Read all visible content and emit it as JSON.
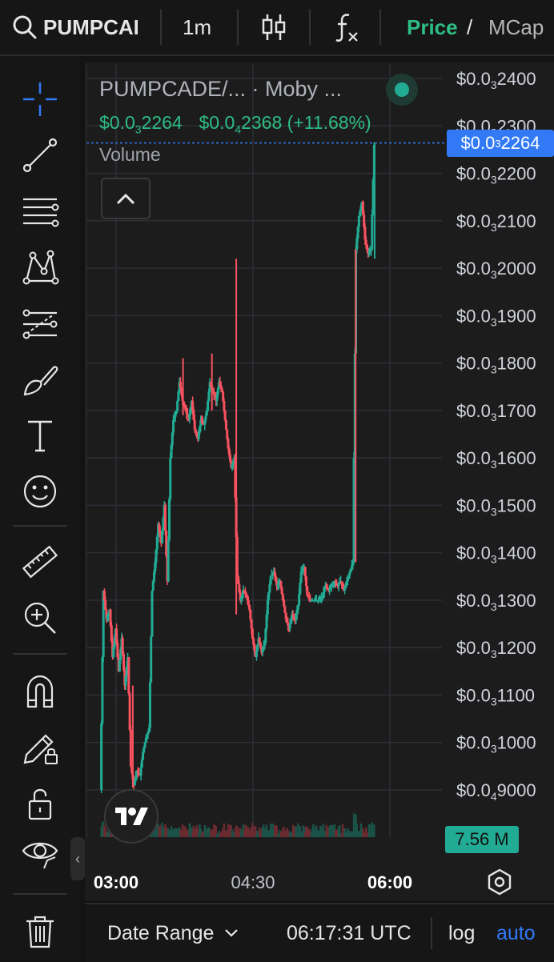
{
  "topbar": {
    "search_text": "PUMPCAD",
    "interval": "1m",
    "price_label": "Price",
    "separator": "/",
    "mcap_label": "MCap"
  },
  "legend": {
    "symbol": "PUMPCADE/... · Moby ...",
    "price_prefix": "$0.0",
    "price_sub": "3",
    "price_rest": "2264",
    "change_prefix": "$0.0",
    "change_sub": "4",
    "change_rest": "2368 (+11.68%)",
    "volume_label": "Volume"
  },
  "axis": {
    "current_price_tag": {
      "prefix": "$0.0",
      "sub": "3",
      "rest": "2264"
    },
    "volume_tag": "7.56 M",
    "partial_label": "00",
    "labels": [
      {
        "prefix": "$0.0",
        "sub": "3",
        "rest": "2400",
        "value": 0.00024
      },
      {
        "prefix": "$0.0",
        "sub": "3",
        "rest": "2300",
        "value": 0.00023
      },
      {
        "prefix": "$0.0",
        "sub": "3",
        "rest": "2200",
        "value": 0.00022
      },
      {
        "prefix": "$0.0",
        "sub": "3",
        "rest": "2100",
        "value": 0.00021
      },
      {
        "prefix": "$0.0",
        "sub": "3",
        "rest": "2000",
        "value": 0.0002
      },
      {
        "prefix": "$0.0",
        "sub": "3",
        "rest": "1900",
        "value": 0.00019
      },
      {
        "prefix": "$0.0",
        "sub": "3",
        "rest": "1800",
        "value": 0.00018
      },
      {
        "prefix": "$0.0",
        "sub": "3",
        "rest": "1700",
        "value": 0.00017
      },
      {
        "prefix": "$0.0",
        "sub": "3",
        "rest": "1600",
        "value": 0.00016
      },
      {
        "prefix": "$0.0",
        "sub": "3",
        "rest": "1500",
        "value": 0.00015
      },
      {
        "prefix": "$0.0",
        "sub": "3",
        "rest": "1400",
        "value": 0.00014
      },
      {
        "prefix": "$0.0",
        "sub": "3",
        "rest": "1300",
        "value": 0.00013
      },
      {
        "prefix": "$0.0",
        "sub": "3",
        "rest": "1200",
        "value": 0.00012
      },
      {
        "prefix": "$0.0",
        "sub": "3",
        "rest": "1100",
        "value": 0.00011
      },
      {
        "prefix": "$0.0",
        "sub": "3",
        "rest": "1000",
        "value": 0.0001
      },
      {
        "prefix": "$0.0",
        "sub": "4",
        "rest": "9000",
        "value": 9e-05
      }
    ],
    "time_labels": [
      {
        "text": "03:00",
        "bold": true,
        "minutes": 180
      },
      {
        "text": "04:30",
        "bold": false,
        "minutes": 270
      },
      {
        "text": "06:00",
        "bold": true,
        "minutes": 360
      }
    ]
  },
  "bottombar": {
    "date_range": "Date Range",
    "time": "06:17:31 UTC",
    "log": "log",
    "auto": "auto"
  },
  "colors": {
    "up": "#22ab94",
    "down": "#f7525f",
    "accent": "#3179f5",
    "price_green": "#2ebd85"
  },
  "chart_data": {
    "type": "candlestick",
    "x_unit": "minutes since 00:00 UTC",
    "ylim": [
      8.9e-05,
      0.000244
    ],
    "current_price": 0.0002264,
    "path": [
      [
        170,
        9e-05
      ],
      [
        172,
        0.000132
      ],
      [
        174,
        0.000126
      ],
      [
        176,
        0.000128
      ],
      [
        178,
        0.000118
      ],
      [
        180,
        0.000124
      ],
      [
        182,
        0.000115
      ],
      [
        184,
        0.000122
      ],
      [
        186,
        0.000112
      ],
      [
        188,
        0.000118
      ],
      [
        190,
        9.5e-05
      ],
      [
        192,
        9.1e-05
      ],
      [
        194,
        9.4e-05
      ],
      [
        196,
        9.3e-05
      ],
      [
        198,
        9.8e-05
      ],
      [
        200,
        0.000101
      ],
      [
        202,
        0.000103
      ],
      [
        204,
        0.000132
      ],
      [
        206,
        0.000138
      ],
      [
        208,
        0.000146
      ],
      [
        210,
        0.000142
      ],
      [
        212,
        0.00015
      ],
      [
        214,
        0.000134
      ],
      [
        216,
        0.00016
      ],
      [
        218,
        0.000168
      ],
      [
        220,
        0.00017
      ],
      [
        222,
        0.000176
      ],
      [
        224,
        0.000172
      ],
      [
        226,
        0.00017
      ],
      [
        228,
        0.000168
      ],
      [
        230,
        0.000172
      ],
      [
        232,
        0.000166
      ],
      [
        234,
        0.000164
      ],
      [
        236,
        0.000168
      ],
      [
        238,
        0.000167
      ],
      [
        240,
        0.00017
      ],
      [
        242,
        0.000176
      ],
      [
        244,
        0.000174
      ],
      [
        246,
        0.000172
      ],
      [
        248,
        0.000176
      ],
      [
        250,
        0.000174
      ],
      [
        252,
        0.000168
      ],
      [
        254,
        0.000162
      ],
      [
        256,
        0.000158
      ],
      [
        258,
        0.00016
      ],
      [
        260,
        0.000135
      ],
      [
        262,
        0.00013
      ],
      [
        264,
        0.000132
      ],
      [
        266,
        0.000131
      ],
      [
        268,
        0.000128
      ],
      [
        270,
        0.000122
      ],
      [
        272,
        0.000118
      ],
      [
        274,
        0.000122
      ],
      [
        276,
        0.000119
      ],
      [
        278,
        0.000121
      ],
      [
        280,
        0.00013
      ],
      [
        282,
        0.000135
      ],
      [
        284,
        0.000136
      ],
      [
        286,
        0.000133
      ],
      [
        288,
        0.000134
      ],
      [
        290,
        0.00013
      ],
      [
        292,
        0.000126
      ],
      [
        294,
        0.000124
      ],
      [
        296,
        0.000127
      ],
      [
        298,
        0.000126
      ],
      [
        300,
        0.000129
      ],
      [
        302,
        0.000136
      ],
      [
        304,
        0.000137
      ],
      [
        306,
        0.000131
      ],
      [
        308,
        0.00013
      ],
      [
        310,
        0.00013
      ],
      [
        312,
        0.00013
      ],
      [
        314,
        0.00013
      ],
      [
        316,
        0.000131
      ],
      [
        318,
        0.000133
      ],
      [
        320,
        0.000132
      ],
      [
        322,
        0.000133
      ],
      [
        324,
        0.000134
      ],
      [
        326,
        0.000133
      ],
      [
        328,
        0.000134
      ],
      [
        330,
        0.000132
      ],
      [
        332,
        0.000134
      ],
      [
        334,
        0.000136
      ],
      [
        336,
        0.000138
      ],
      [
        338,
        0.000204
      ],
      [
        340,
        0.000211
      ],
      [
        342,
        0.000214
      ],
      [
        344,
        0.000206
      ],
      [
        346,
        0.000203
      ],
      [
        348,
        0.000204
      ],
      [
        350,
        0.000226
      ]
    ]
  }
}
